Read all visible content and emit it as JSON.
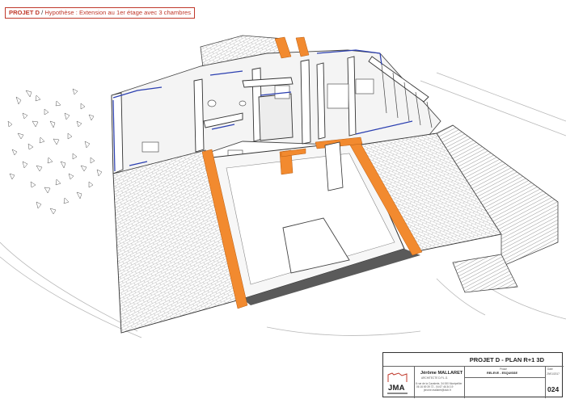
{
  "header": {
    "project": "PROJET D",
    "separator": " / ",
    "hypothesis": "Hypothèse : Extension au 1er étage avec 3 chambres"
  },
  "drawing": {
    "plan_label": "R+1",
    "colors": {
      "wall_cut": "#f28a2f",
      "roof_tile": "#ffffff",
      "tile_line": "#9a9a9a",
      "blue_accent": "#2b3fb0",
      "dark_edge": "#555555"
    }
  },
  "title_block": {
    "sheet_title": "PROJET D - PLAN R+1 3D",
    "architect_name": "Jérôme MALLARET",
    "architect_title": "ARCHITECTE D.P.L.G.",
    "address": "8 rue de la Cavalerie, 34 000 Montpellier",
    "phone": "06 16 69 39 72 - 04 67 46 34 19",
    "email": "jerome.mallaret@club.fr",
    "phase_label": "Phase",
    "phase_value": "RELEVE - ESQUISSE",
    "date_label": "Date",
    "date_value": "29/01/2017",
    "sheet_number": "024",
    "logo_text": "JMA"
  }
}
